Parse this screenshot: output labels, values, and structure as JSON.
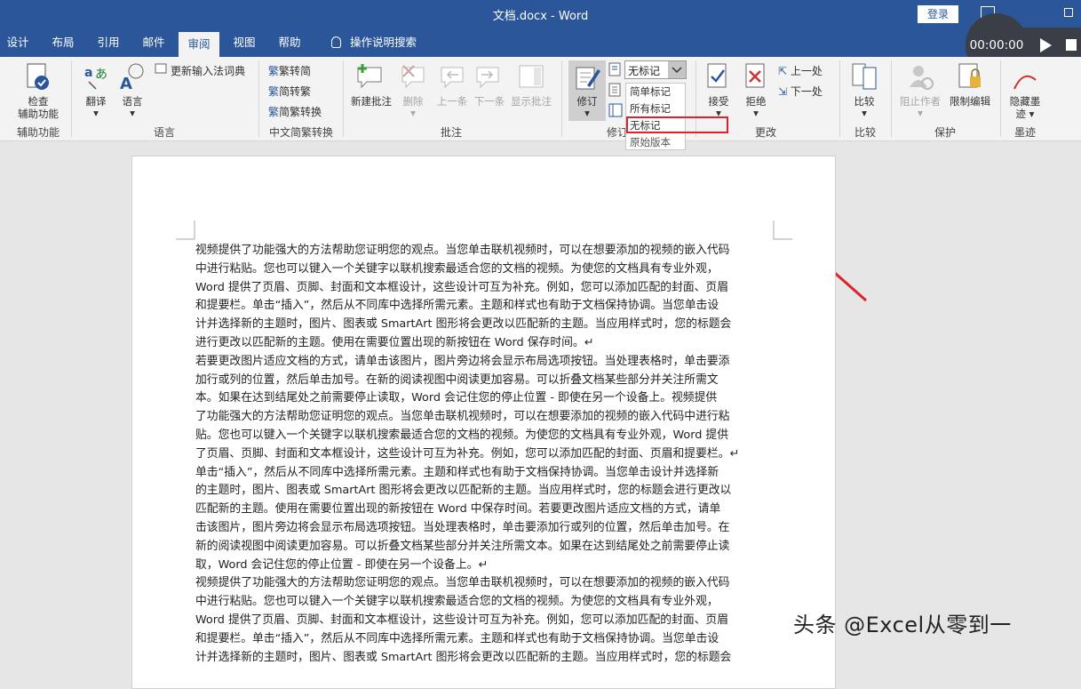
{
  "window": {
    "title": "文档.docx  -  Word",
    "login_label": "登录"
  },
  "tabs": [
    "设计",
    "布局",
    "引用",
    "邮件",
    "审阅",
    "视图",
    "帮助",
    "操作说明搜索"
  ],
  "timer": {
    "time": "00:00:00"
  },
  "ribbon": {
    "check": {
      "label1": "检查",
      "label2": "辅助功能",
      "group": "辅助功能"
    },
    "language": {
      "translate": "翻译",
      "language": "语言",
      "update_ime": "更新输入法词典",
      "group": "语言"
    },
    "chinese": {
      "to_trad": "繁转简",
      "to_simp": "简转繁",
      "convert": "简繁转换",
      "group": "中文简繁转换"
    },
    "comments": {
      "new": "新建批注",
      "delete": "删除",
      "prev": "上一条",
      "next": "下一条",
      "show": "显示批注",
      "group": "批注"
    },
    "tracking": {
      "track": "修订",
      "group": "修订",
      "combo_value": "无标记"
    },
    "changes": {
      "accept": "接受",
      "reject": "拒绝",
      "prev": "上一处",
      "next": "下一处",
      "group": "更改"
    },
    "compare": {
      "label": "比较",
      "group": "比较"
    },
    "protect": {
      "block": "阻止作者",
      "restrict": "限制编辑",
      "group": "保护"
    },
    "ink": {
      "hide1": "隐藏墨",
      "hide2": "迹",
      "group": "墨迹"
    }
  },
  "markup_options": [
    "简单标记",
    "所有标记",
    "无标记",
    "原始版本"
  ],
  "doc": {
    "lines": [
      "视频提供了功能强大的方法帮助您证明您的观点。当您单击联机视频时，可以在想要添加的视频的嵌入代码",
      "中进行粘贴。您也可以键入一个关键字以联机搜索最适合您的文档的视频。为使您的文档具有专业外观，",
      "Word 提供了页眉、页脚、封面和文本框设计，这些设计可互为补充。例如，您可以添加匹配的封面、页眉",
      "和提要栏。单击“插入”，然后从不同库中选择所需元素。主题和样式也有助于文档保持协调。当您单击设",
      "计并选择新的主题时，图片、图表或 SmartArt 图形将会更改以匹配新的主题。当应用样式时，您的标题会",
      "进行更改以匹配新的主题。使用在需要位置出现的新按钮在 Word 保存时间。↵",
      "若要更改图片适应文档的方式，请单击该图片，图片旁边将会显示布局选项按钮。当处理表格时，单击要添",
      "加行或列的位置，然后单击加号。在新的阅读视图中阅读更加容易。可以折叠文档某些部分并关注所需文",
      "本。如果在达到结尾处之前需要停止读取，Word 会记住您的停止位置 - 即使在另一个设备上。视频提供",
      "了功能强大的方法帮助您证明您的观点。当您单击联机视频时，可以在想要添加的视频的嵌入代码中进行粘",
      "贴。您也可以键入一个关键字以联机搜索最适合您的文档的视频。为使您的文档具有专业外观，Word 提供",
      "了页眉、页脚、封面和文本框设计，这些设计可互为补充。例如，您可以添加匹配的封面、页眉和提要栏。↵",
      "单击“插入”，然后从不同库中选择所需元素。主题和样式也有助于文档保持协调。当您单击设计并选择新",
      "的主题时，图片、图表或 SmartArt 图形将会更改以匹配新的主题。当应用样式时，您的标题会进行更改以",
      "匹配新的主题。使用在需要位置出现的新按钮在 Word 中保存时间。若要更改图片适应文档的方式，请单",
      "击该图片，图片旁边将会显示布局选项按钮。当处理表格时，单击要添加行或列的位置，然后单击加号。在",
      "新的阅读视图中阅读更加容易。可以折叠文档某些部分并关注所需文本。如果在达到结尾处之前需要停止读",
      "取，Word 会记住您的停止位置 - 即使在另一个设备上。↵",
      "视频提供了功能强大的方法帮助您证明您的观点。当您单击联机视频时，可以在想要添加的视频的嵌入代码",
      "中进行粘贴。您也可以键入一个关键字以联机搜索最适合您的文档的视频。为使您的文档具有专业外观，",
      "Word 提供了页眉、页脚、封面和文本框设计，这些设计可互为补充。例如，您可以添加匹配的封面、页眉",
      "和提要栏。单击“插入”，然后从不同库中选择所需元素。主题和样式也有助于文档保持协调。当您单击设",
      "计并选择新的主题时，图片、图表或 SmartArt 图形将会更改以匹配新的主题。当应用样式时，您的标题会"
    ]
  },
  "watermark": "头条 @Excel从零到一",
  "colors": {
    "titlebar": "#2b579a",
    "ribbon": "#f3f3f3",
    "highlight": "#e0202a"
  }
}
